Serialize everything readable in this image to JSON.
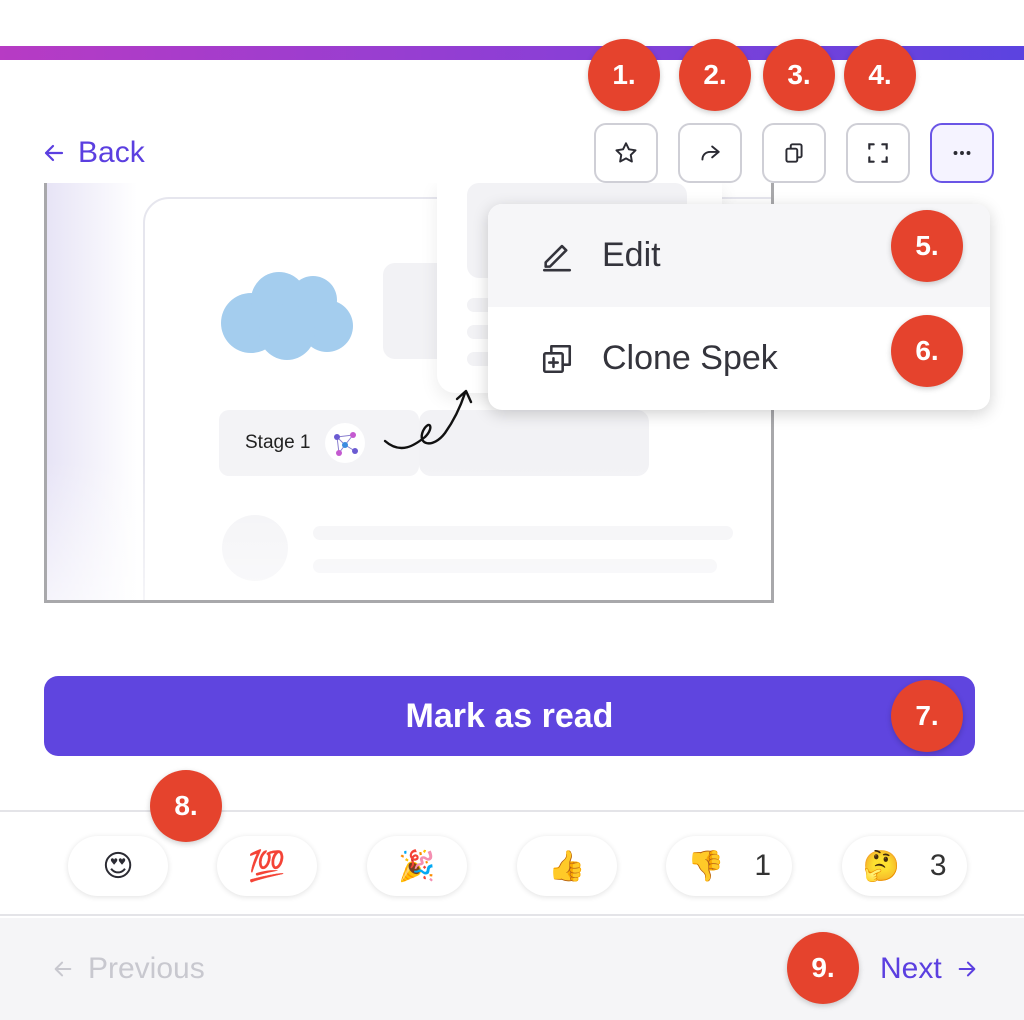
{
  "header": {
    "accent_gradient": [
      "#b73bc4",
      "#5b43e0"
    ]
  },
  "nav": {
    "back_label": "Back"
  },
  "toolbar": {
    "buttons": [
      {
        "name": "favorite",
        "icon": "star-icon"
      },
      {
        "name": "share",
        "icon": "share-arrow-icon"
      },
      {
        "name": "copy",
        "icon": "copy-icon"
      },
      {
        "name": "fullscreen",
        "icon": "fullscreen-icon"
      },
      {
        "name": "more",
        "icon": "more-horizontal-icon"
      }
    ]
  },
  "menu": {
    "items": [
      {
        "label": "Edit",
        "icon": "pencil-icon"
      },
      {
        "label": "Clone Spek",
        "icon": "clone-icon"
      }
    ]
  },
  "preview": {
    "stage_label": "Stage 1"
  },
  "primary_action": {
    "label": "Mark as read",
    "color": "#5f45df"
  },
  "reactions": [
    {
      "emoji": "😍",
      "name": "heart-eyes",
      "count": ""
    },
    {
      "emoji": "💯",
      "name": "hundred",
      "count": ""
    },
    {
      "emoji": "🎉",
      "name": "party-popper",
      "count": ""
    },
    {
      "emoji": "👍",
      "name": "thumbs-up",
      "count": ""
    },
    {
      "emoji": "👎",
      "name": "thumbs-down",
      "count": "1"
    },
    {
      "emoji": "🤔",
      "name": "thinking-face",
      "count": "3"
    }
  ],
  "pagination": {
    "previous_label": "Previous",
    "next_label": "Next"
  },
  "badges": [
    "1.",
    "2.",
    "3.",
    "4.",
    "5.",
    "6.",
    "7.",
    "8.",
    "9."
  ],
  "badge_color": "#e5432d"
}
